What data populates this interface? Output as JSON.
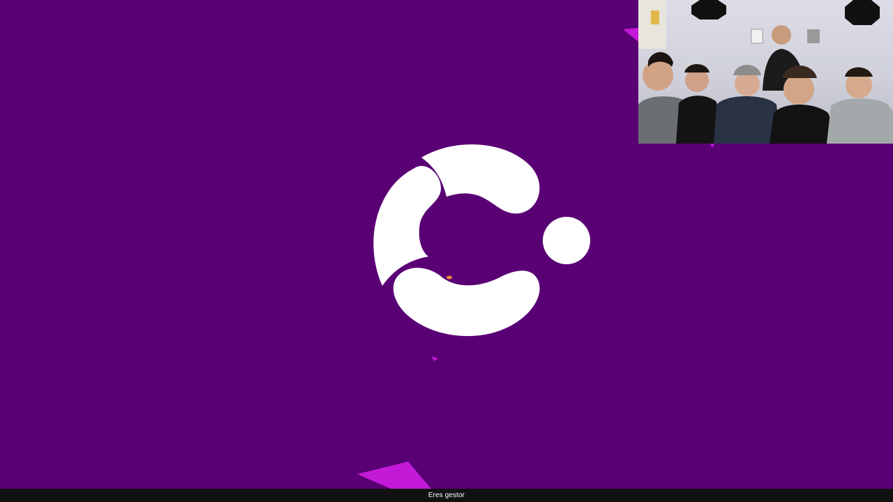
{
  "colors": {
    "background": "#5a0075",
    "logo": "#ffffff",
    "accent": "#c21ad6",
    "statusbar": "#111111"
  },
  "logo": {
    "icon": "segmented-c-logo-icon"
  },
  "webcam": {
    "content": "people-group-overlay"
  },
  "statusbar": {
    "label": "Eres gestor"
  }
}
